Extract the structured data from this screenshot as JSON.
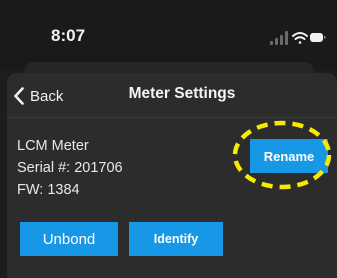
{
  "status_bar": {
    "time": "8:07",
    "icons": [
      "signal-icon",
      "wifi-icon",
      "battery-icon"
    ]
  },
  "nav": {
    "back_label": "Back",
    "title": "Meter Settings"
  },
  "meter": {
    "name": "LCM Meter",
    "serial": "Serial #: 201706",
    "firmware": "FW: 1384"
  },
  "buttons": {
    "rename": "Rename",
    "unbond": "Unbond",
    "identify": "Identify"
  },
  "colors": {
    "background": "#1d1d1d",
    "sheet": "#2c2c2c",
    "button_accent": "#1798e6",
    "highlight": "#f5ea00"
  }
}
